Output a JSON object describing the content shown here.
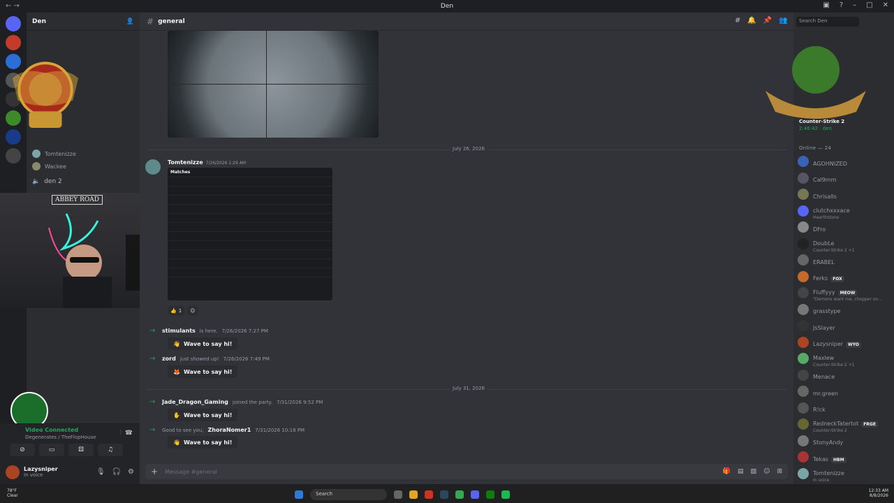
{
  "window": {
    "title": "Den",
    "accent": "#5865f2",
    "online_color": "#23a55a"
  },
  "server": {
    "name": "Den"
  },
  "sidebar": {
    "voice_users": [
      "Tomtenizze",
      "Wackee"
    ],
    "voice_channel": "den 2",
    "webcam_sign": "ABBEY ROAD"
  },
  "voice_panel": {
    "status": "Video Connected",
    "sub": "Degenerates / TheFlopHouse"
  },
  "user_panel": {
    "name": "Lazysniper",
    "status": "In voice"
  },
  "channel": {
    "name": "general"
  },
  "search": {
    "placeholder": "Search Den"
  },
  "chat": {
    "date1": "July 26, 2026",
    "msg1": {
      "author": "Tomtenizze",
      "time": "7/26/2026 1:29 AM",
      "image_title": "Matches",
      "reaction_count": "1"
    },
    "sys1": {
      "user": "stimulants",
      "text": "is here.",
      "time": "7/26/2026 7:27 PM"
    },
    "sys2": {
      "user": "zord",
      "text": "just showed up!",
      "time": "7/26/2026 7:49 PM"
    },
    "date2": "July 31, 2026",
    "sys3": {
      "user": "Jade_Dragon_Gaming",
      "text": "joined the party.",
      "time": "7/31/2026 9:52 PM"
    },
    "sys4": {
      "prefix": "Good to see you,",
      "user": "ZhoraNomer1",
      "time": "7/31/2026 10:18 PM"
    },
    "wave_label": "Wave to say hi!",
    "composer_placeholder": "Message #general"
  },
  "members": {
    "activity": {
      "game": "Counter-Strike 2",
      "time": "2:46:42",
      "user": "den"
    },
    "online_header": "Online — 24",
    "list": [
      {
        "name": "AGOHNIZED",
        "sub": "",
        "tag": ""
      },
      {
        "name": "Cal9mm",
        "sub": "",
        "tag": ""
      },
      {
        "name": "Chrisalls",
        "sub": "",
        "tag": ""
      },
      {
        "name": "clutchxxxace",
        "sub": "Hearthstone",
        "tag": ""
      },
      {
        "name": "DFro",
        "sub": "",
        "tag": ""
      },
      {
        "name": "DoubLe",
        "sub": "Counter-Strike 2 +1",
        "tag": ""
      },
      {
        "name": "ERABEL",
        "sub": "",
        "tag": ""
      },
      {
        "name": "Ferks",
        "sub": "",
        "tag": "FOX"
      },
      {
        "name": "Fluffyyy",
        "sub": "\"Demons want me, chopper on...",
        "tag": "MEOW"
      },
      {
        "name": "grasstype",
        "sub": "",
        "tag": ""
      },
      {
        "name": "JsSlayer",
        "sub": "",
        "tag": ""
      },
      {
        "name": "Lazysniper",
        "sub": "",
        "tag": "WYO"
      },
      {
        "name": "Maxlew",
        "sub": "Counter-Strike 2 +1",
        "tag": ""
      },
      {
        "name": "Menace",
        "sub": "",
        "tag": ""
      },
      {
        "name": "mr.green",
        "sub": "",
        "tag": ""
      },
      {
        "name": "R!ck",
        "sub": "",
        "tag": ""
      },
      {
        "name": "RedneckTatertot",
        "sub": "Counter-Strike 2",
        "tag": "FRGE"
      },
      {
        "name": "StonyAndy",
        "sub": "",
        "tag": ""
      },
      {
        "name": "Tekas",
        "sub": "",
        "tag": "HBM"
      },
      {
        "name": "Tomtenizze",
        "sub": "In voice",
        "tag": ""
      }
    ]
  },
  "taskbar": {
    "weather_temp": "78°F",
    "weather_text": "Clear",
    "search": "Search",
    "time": "12:33 AM",
    "date": "8/8/2026"
  }
}
